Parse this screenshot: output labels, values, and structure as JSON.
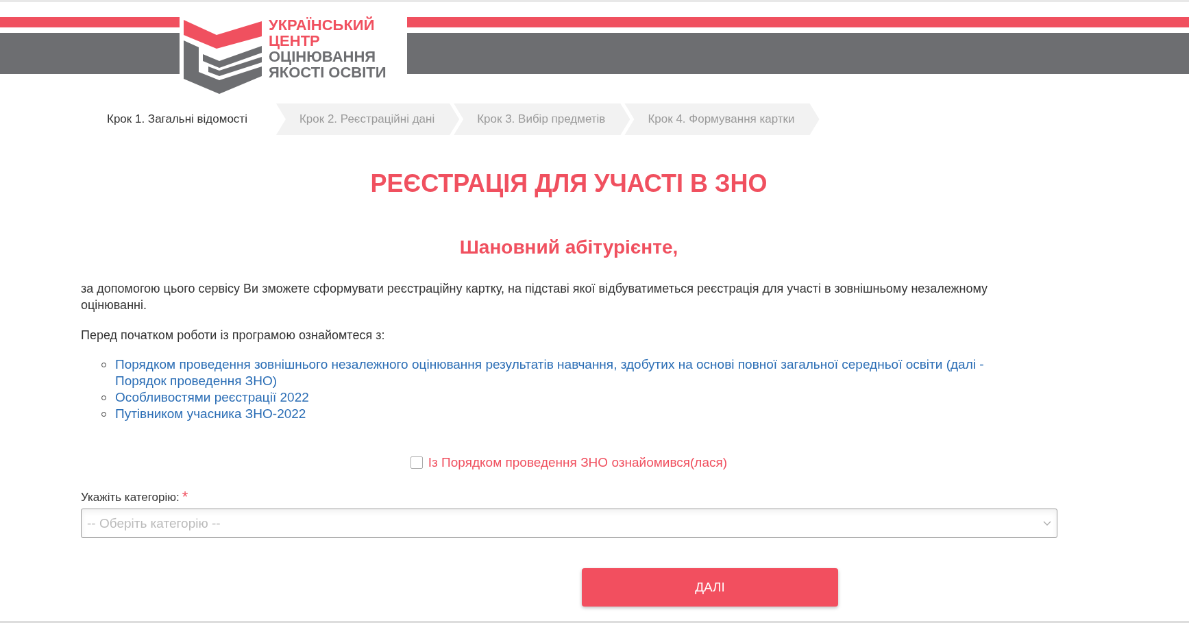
{
  "logo": {
    "lines": [
      {
        "text": "УКРАЇНСЬКИЙ",
        "accent": true
      },
      {
        "text": "ЦЕНТР",
        "accent": true
      },
      {
        "text": "ОЦІНЮВАННЯ",
        "accent": false
      },
      {
        "text": "ЯКОСТІ ОСВІТИ",
        "accent": false
      }
    ]
  },
  "steps": [
    {
      "label": "Крок 1. Загальні відомості",
      "selected": true
    },
    {
      "label": "Крок 2. Реєстраційні дані",
      "selected": false
    },
    {
      "label": "Крок 3. Вибір предметів",
      "selected": false
    },
    {
      "label": "Крок 4. Формування картки",
      "selected": false
    }
  ],
  "title": "РЕЄСТРАЦІЯ ДЛЯ УЧАСТІ В ЗНО",
  "greeting": "Шановний абітурієнте,",
  "intro": "за допомогою цього сервісу Ви зможете сформувати реєстраційну картку, на підставі якої відбуватиметься реєстрація для участі в зовнішньому незалежному оцінюванні.",
  "before": "Перед початком роботи із програмою ознайомтеся з:",
  "links": [
    "Порядком проведення зовнішнього незалежного оцінювання результатів навчання, здобутих на основі повної загальної середньої освіти (далі - Порядок проведення ЗНО)",
    "Особливостями реєстрації 2022",
    "Путівником учасника ЗНО-2022"
  ],
  "agreement": {
    "label": "Із Порядком проведення ЗНО ознайомився(лася)",
    "checked": false
  },
  "category": {
    "label": "Укажіть категорію:",
    "required_mark": "*",
    "placeholder": "-- Оберіть категорію --"
  },
  "next_button": "ДАЛІ"
}
